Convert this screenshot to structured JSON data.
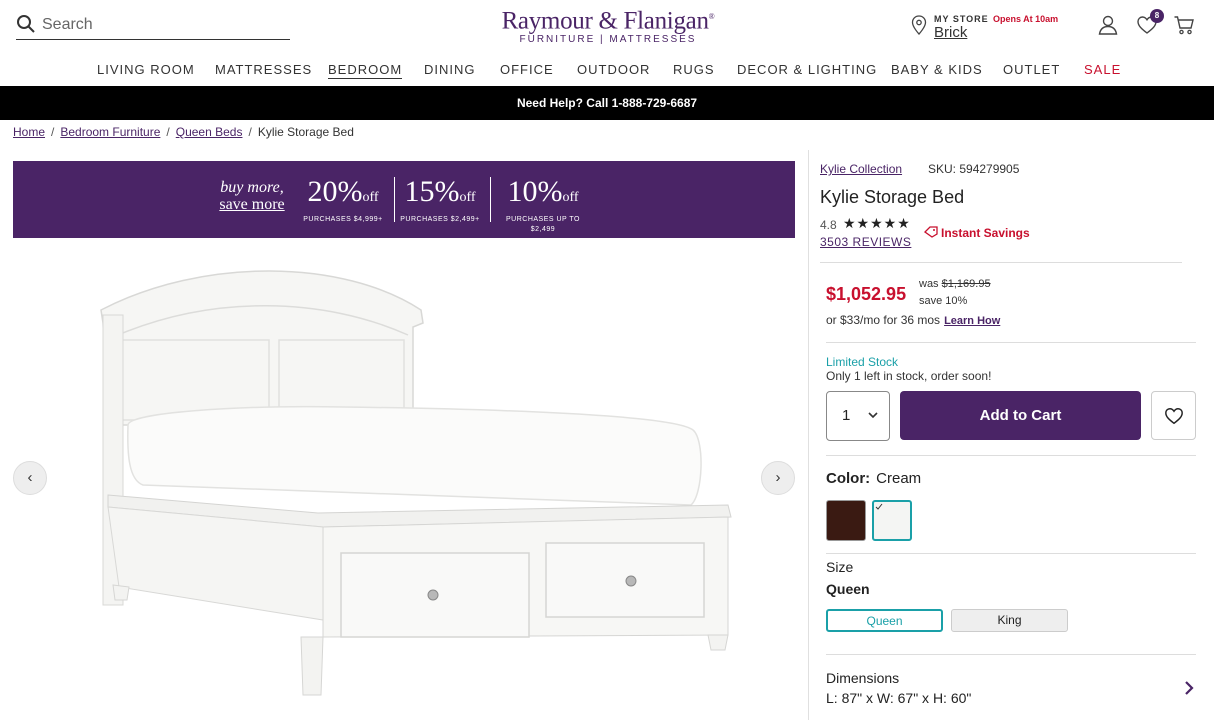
{
  "header": {
    "search_placeholder": "Search",
    "logo_main": "Raymour & Flanigan",
    "logo_registered": "®",
    "logo_sub": "FURNITURE | MATTRESSES",
    "store_label": "MY STORE",
    "store_hours": "Opens At 10am",
    "store_name": "Brick",
    "wishlist_count": "8"
  },
  "nav": {
    "items": [
      "LIVING ROOM",
      "MATTRESSES",
      "BEDROOM",
      "DINING",
      "OFFICE",
      "OUTDOOR",
      "RUGS",
      "DECOR & LIGHTING",
      "BABY & KIDS",
      "OUTLET",
      "SALE"
    ],
    "active": "BEDROOM"
  },
  "helpbar": {
    "text": "Need Help? Call 1-888-729-6687"
  },
  "breadcrumb": {
    "items": [
      "Home",
      "Bedroom Furniture",
      "Queen Beds"
    ],
    "current": "Kylie Storage Bed",
    "separator": "/"
  },
  "promo": {
    "line1": "buy more,",
    "line2": "save more",
    "deals": [
      {
        "pct": "20%",
        "off": "off",
        "cond": "PURCHASES $4,999+"
      },
      {
        "pct": "15%",
        "off": "off",
        "cond": "PURCHASES $2,499+"
      },
      {
        "pct": "10%",
        "off": "off",
        "cond": "PURCHASES UP TO $2,499"
      }
    ]
  },
  "gallery": {
    "prev": "‹",
    "next": "›"
  },
  "product": {
    "collection": "Kylie Collection",
    "sku": "SKU: 594279905",
    "title": "Kylie Storage Bed",
    "rating": "4.8",
    "stars": "★★★★★",
    "reviews": "3503 REVIEWS",
    "instant_savings": "Instant Savings",
    "price": "$1,052.95",
    "was_label": "was",
    "was_price": "$1,169.95",
    "save": "save 10%",
    "monthly": "or $33/mo for 36 mos",
    "learn_how": "Learn How",
    "stock_status": "Limited Stock",
    "stock_note": "Only 1 left in stock, order soon!",
    "qty": "1",
    "add_to_cart": "Add to Cart",
    "color_label": "Color:",
    "color_value": "Cream",
    "colors": [
      "#3a1a12",
      "#f4f5f3"
    ],
    "selected_color_index": 1,
    "size_label": "Size",
    "size_value": "Queen",
    "sizes": [
      "Queen",
      "King"
    ],
    "selected_size": "Queen",
    "dimensions_label": "Dimensions",
    "dimensions_value": "L: 87\" x W: 67\" x H: 60\""
  },
  "colors": {
    "brand": "#4a2466",
    "sale": "#c8102e",
    "teal": "#1aa0a8"
  }
}
